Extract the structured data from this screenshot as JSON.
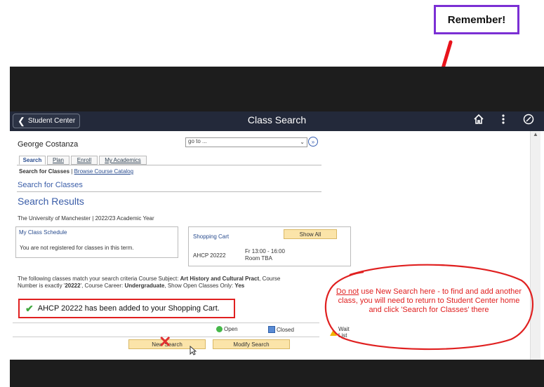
{
  "annotation": {
    "label": "Remember!",
    "note_prefix": "Do not",
    "note_body": " use New Search here - to find and add another class, you will need to return to Student Center home and click  'Search for Classes' there"
  },
  "navbar": {
    "back_label": "Student Center",
    "title": "Class Search",
    "icons": [
      "home-icon",
      "more-vert-icon",
      "compass-icon"
    ]
  },
  "user": {
    "name": "George Costanza"
  },
  "goto": {
    "value": "go to ..."
  },
  "tabs": [
    {
      "label": "Search",
      "active": true
    },
    {
      "label": "Plan",
      "active": false
    },
    {
      "label": "Enroll",
      "active": false
    },
    {
      "label": "My Academics",
      "active": false
    }
  ],
  "subnav": {
    "current": "Search for Classes",
    "separator": "|",
    "link": "Browse Course Catalog"
  },
  "section_title": "Search for Classes",
  "results_title": "Search Results",
  "institution": "The University of Manchester | 2022/23 Academic Year",
  "schedule": {
    "title": "My Class Schedule",
    "message": "You are not registered for classes in this term."
  },
  "cart": {
    "title": "Shopping Cart",
    "show_all": "Show All",
    "course": "AHCP 20222",
    "time": "Fr 13:00 - 16:00",
    "room": "Room  TBA"
  },
  "criteria": {
    "t1": "The following classes match your search criteria Course Subject: ",
    "subject": "Art History and Cultural Pract",
    "t2": ",  Course Number is exactly '",
    "number": "20222",
    "t3": "',  Course Career: ",
    "career": "Undergraduate",
    "t4": ",  Show Open Classes Only: ",
    "open_only": "Yes"
  },
  "message": {
    "text": "AHCP 20222 has been added to your Shopping Cart."
  },
  "legend": {
    "open": "Open",
    "closed": "Closed",
    "wait": "Wait List"
  },
  "buttons": {
    "new_search": "New Search",
    "modify_search": "Modify Search"
  },
  "colors": {
    "annotation_red": "#e02020",
    "remember_border": "#7b2fd4",
    "link_blue": "#3a5da8",
    "button_yellow": "#fbe4a9"
  }
}
